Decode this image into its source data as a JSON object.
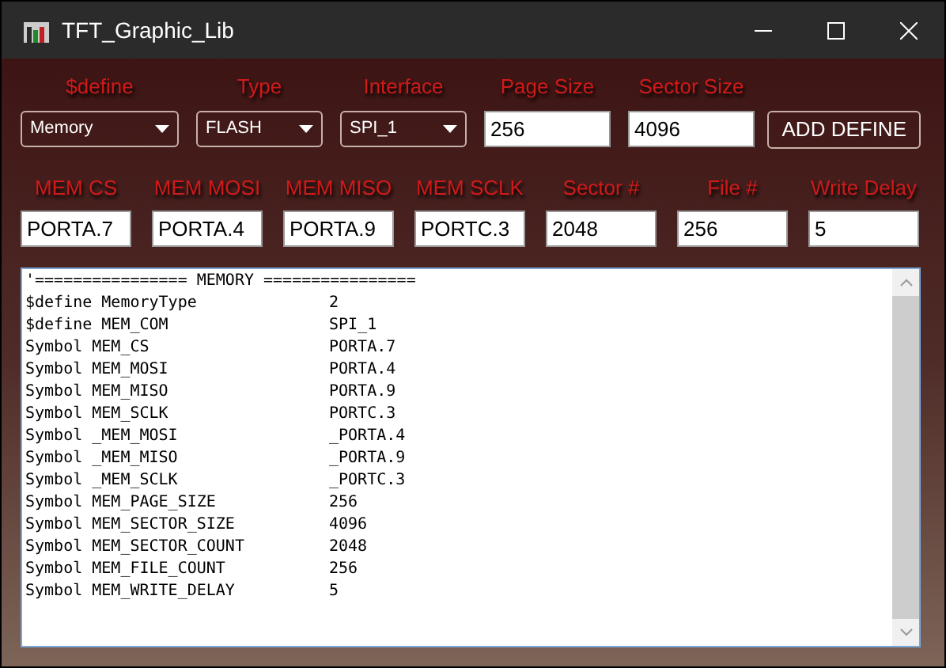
{
  "window": {
    "title": "TFT_Graphic_Lib"
  },
  "row_1": [
    {
      "label": "$define",
      "kind": "dropdown",
      "value": "Memory"
    },
    {
      "label": "Type",
      "kind": "dropdown",
      "value": "FLASH"
    },
    {
      "label": "Interface",
      "kind": "dropdown",
      "value": "SPI_1"
    },
    {
      "label": "Page Size",
      "kind": "input",
      "value": "256"
    },
    {
      "label": "Sector Size",
      "kind": "input",
      "value": "4096"
    }
  ],
  "add_button": "ADD DEFINE",
  "row_2": [
    {
      "label": "MEM CS",
      "value": "PORTA.7"
    },
    {
      "label": "MEM MOSI",
      "value": "PORTA.4"
    },
    {
      "label": "MEM MISO",
      "value": "PORTA.9"
    },
    {
      "label": "MEM SCLK",
      "value": "PORTC.3"
    },
    {
      "label": "Sector #",
      "value": "2048"
    },
    {
      "label": "File #",
      "value": "256"
    },
    {
      "label": "Write Delay",
      "value": "5"
    }
  ],
  "output": {
    "header": "'================ MEMORY ================",
    "lines": [
      {
        "name": "$define MemoryType",
        "value": "2"
      },
      {
        "name": "$define MEM_COM",
        "value": "SPI_1"
      },
      {
        "name": "Symbol MEM_CS",
        "value": "PORTA.7"
      },
      {
        "name": "Symbol MEM_MOSI",
        "value": "PORTA.4"
      },
      {
        "name": "Symbol MEM_MISO",
        "value": "PORTA.9"
      },
      {
        "name": "Symbol MEM_SCLK",
        "value": "PORTC.3"
      },
      {
        "name": "Symbol _MEM_MOSI",
        "value": "_PORTA.4"
      },
      {
        "name": "Symbol _MEM_MISO",
        "value": "_PORTA.9"
      },
      {
        "name": "Symbol _MEM_SCLK",
        "value": "_PORTC.3"
      },
      {
        "name": "Symbol MEM_PAGE_SIZE",
        "value": "256"
      },
      {
        "name": "Symbol MEM_SECTOR_SIZE",
        "value": "4096"
      },
      {
        "name": "Symbol MEM_SECTOR_COUNT",
        "value": "2048"
      },
      {
        "name": "Symbol MEM_FILE_COUNT",
        "value": "256"
      },
      {
        "name": "Symbol MEM_WRITE_DELAY",
        "value": "5"
      }
    ]
  }
}
